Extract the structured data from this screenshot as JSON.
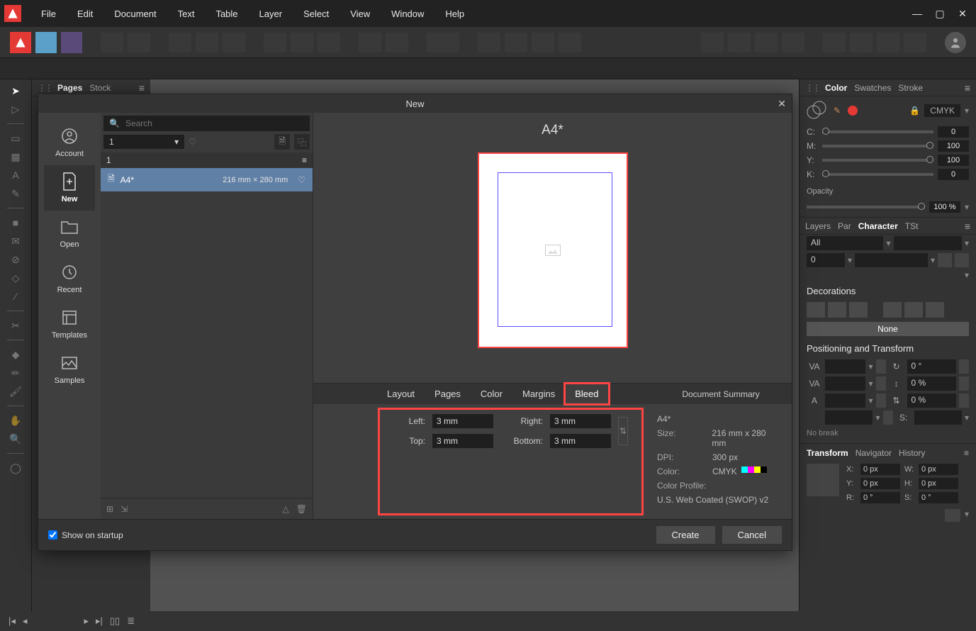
{
  "menu": {
    "file": "File",
    "edit": "Edit",
    "document": "Document",
    "text": "Text",
    "table": "Table",
    "layer": "Layer",
    "select": "Select",
    "view": "View",
    "window": "Window",
    "help": "Help"
  },
  "left_panel": {
    "tab_pages": "Pages",
    "tab_stock": "Stock"
  },
  "right_panel": {
    "color_tab": "Color",
    "swatches_tab": "Swatches",
    "stroke_tab": "Stroke",
    "color_mode": "CMYK",
    "c_label": "C:",
    "m_label": "M:",
    "y_label": "Y:",
    "k_label": "K:",
    "c_val": "0",
    "m_val": "100",
    "y_val": "100",
    "k_val": "0",
    "opacity_label": "Opacity",
    "opacity_val": "100 %",
    "layers_tab": "Layers",
    "par_tab": "Par",
    "character_tab": "Character",
    "tst_tab": "TSt",
    "lang_sel": "All",
    "font_sel": "0",
    "decorations": "Decorations",
    "none": "None",
    "pos_tf": "Positioning and Transform",
    "va": "VA",
    "va2": "VA",
    "aa": "A",
    "deg0": "0 °",
    "pct0": "0 %",
    "nobreak": "No break",
    "transform_tab": "Transform",
    "navigator_tab": "Navigator",
    "history_tab": "History",
    "x": "X:",
    "y": "Y:",
    "w": "W:",
    "h": "H:",
    "r": "R:",
    "s": "S:",
    "xval": "0 px",
    "yval": "0 px",
    "wval": "0 px",
    "hval": "0 px",
    "rval": "0 °",
    "sval": "0 °"
  },
  "dialog": {
    "title": "New",
    "sidebar": {
      "account": "Account",
      "new": "New",
      "open": "Open",
      "recent": "Recent",
      "templates": "Templates",
      "samples": "Samples"
    },
    "search_placeholder": "Search",
    "preset_group_sel": "1",
    "category": "1",
    "preset_name": "A4*",
    "preset_dim": "216 mm × 280 mm",
    "preview_name": "A4*",
    "tabs": {
      "layout": "Layout",
      "pages": "Pages",
      "color": "Color",
      "margins": "Margins",
      "bleed": "Bleed"
    },
    "summary_head": "Document Summary",
    "bleed": {
      "left_l": "Left:",
      "right_l": "Right:",
      "top_l": "Top:",
      "bottom_l": "Bottom:",
      "left": "3 mm",
      "right": "3 mm",
      "top": "3 mm",
      "bottom": "3 mm"
    },
    "summary": {
      "name": "A4*",
      "size_l": "Size:",
      "size": "216 mm  x  280 mm",
      "dpi_l": "DPI:",
      "dpi": "300 px",
      "color_l": "Color:",
      "color": "CMYK",
      "profile_l": "Color Profile:",
      "profile": "U.S. Web Coated (SWOP) v2"
    },
    "show_startup": "Show on startup",
    "create": "Create",
    "cancel": "Cancel"
  }
}
